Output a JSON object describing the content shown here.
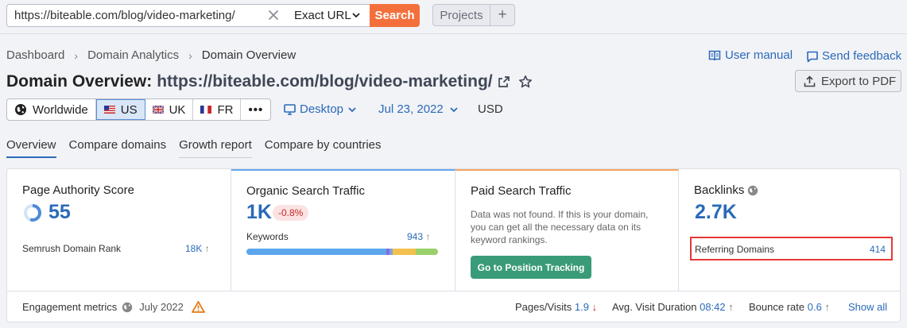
{
  "search": {
    "url_value": "https://biteable.com/blog/video-marketing/",
    "match_type": "Exact URL",
    "search_label": "Search",
    "projects_label": "Projects",
    "add_label": "+"
  },
  "breadcrumb": [
    "Dashboard",
    "Domain Analytics",
    "Domain Overview"
  ],
  "header": {
    "user_manual": "User manual",
    "send_feedback": "Send feedback",
    "title_prefix": "Domain Overview:",
    "title_domain": "https://biteable.com/blog/video-marketing/",
    "export_label": "Export to PDF"
  },
  "databases": {
    "worldwide": "Worldwide",
    "us": "US",
    "uk": "UK",
    "fr": "FR",
    "more": "•••"
  },
  "filters": {
    "device": "Desktop",
    "date": "Jul 23, 2022",
    "currency": "USD"
  },
  "tabs": [
    "Overview",
    "Compare domains",
    "Growth report",
    "Compare by countries"
  ],
  "cards": {
    "authority": {
      "title": "Page Authority Score",
      "value": "55",
      "rank_label": "Semrush Domain Rank",
      "rank_value": "18K",
      "rank_arrow": "↑"
    },
    "organic": {
      "title": "Organic Search Traffic",
      "value": "1K",
      "change": "-0.8%",
      "keywords_label": "Keywords",
      "keywords_value": "943",
      "keywords_arrow": "↑"
    },
    "paid": {
      "title": "Paid Search Traffic",
      "message": "Data was not found. If this is your domain, you can get all the necessary data on its keyword rankings.",
      "button_label": "Go to Position Tracking"
    },
    "backlinks": {
      "title": "Backlinks",
      "value": "2.7K",
      "referring_label": "Referring Domains",
      "referring_value": "414"
    }
  },
  "engagement": {
    "label": "Engagement metrics",
    "date": "July 2022",
    "pages_label": "Pages/Visits",
    "pages_value": "1.9",
    "pages_arrow": "↓",
    "duration_label": "Avg. Visit Duration",
    "duration_value": "08:42",
    "duration_arrow": "↑",
    "bounce_label": "Bounce rate",
    "bounce_value": "0.6",
    "bounce_arrow": "↑",
    "show_all": "Show all"
  },
  "colors": {
    "accent": "#2a6ab8",
    "search_button": "#f3703c",
    "green_button": "#3a9b78",
    "highlight": "#e53935",
    "card_top_blue": "#64a8ec",
    "card_top_orange": "#f3a45e"
  }
}
